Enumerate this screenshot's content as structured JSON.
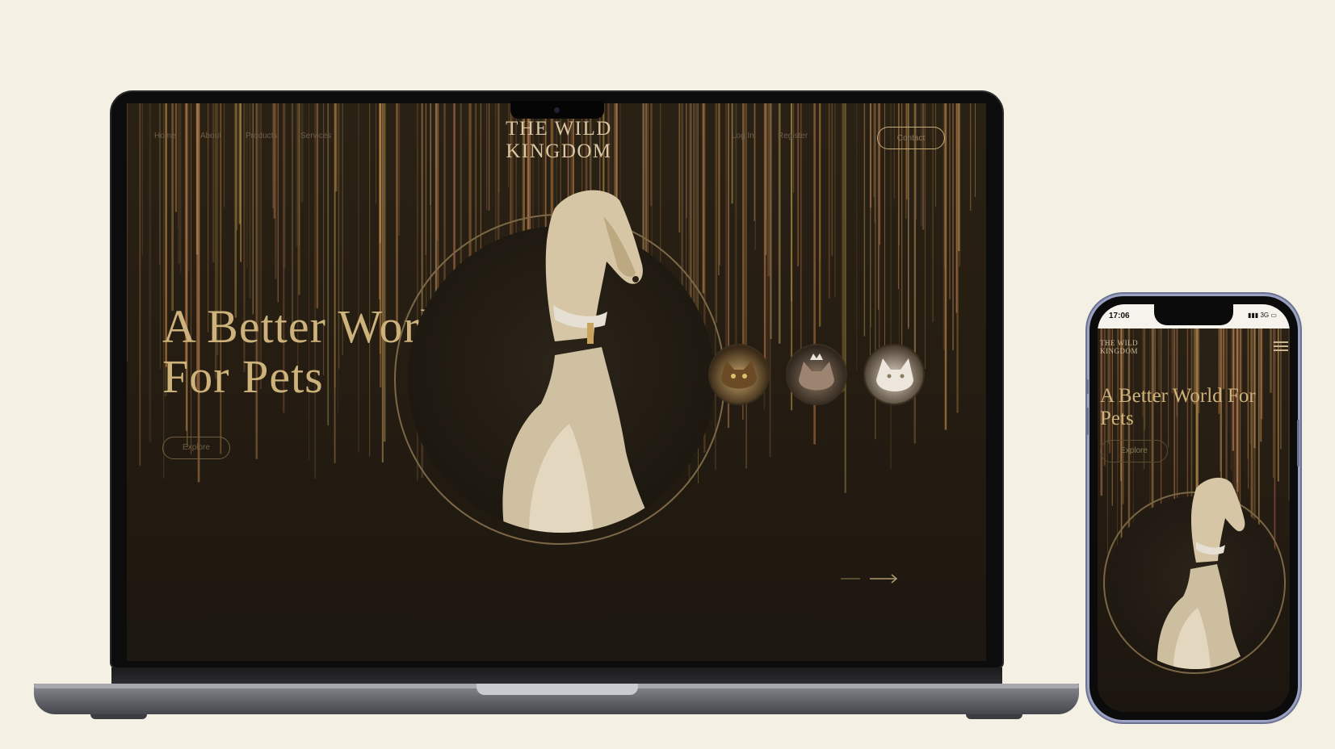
{
  "desktop": {
    "nav": {
      "left": [
        "Home",
        "About",
        "Products",
        "Services"
      ],
      "right": [
        "Log In",
        "Register"
      ],
      "contact_label": "Contact"
    },
    "logo": {
      "line1": "THE WILD",
      "line2": "KINGDOM"
    },
    "hero": {
      "title_line1": "A Better World",
      "title_line2": "For Pets",
      "button_label": "Explore"
    },
    "featured_pet": "dog-portrait-icon",
    "thumbnails": [
      "cat-portrait-icon",
      "cat-portrait-icon",
      "cat-portrait-icon"
    ]
  },
  "mobile": {
    "status": {
      "time": "17:06",
      "signal": "3G"
    },
    "logo": {
      "line1": "THE WILD",
      "line2": "KINGDOM"
    },
    "hero": {
      "title_line1": "A Better World For",
      "title_line2": "Pets",
      "button_label": "Explore"
    }
  },
  "colors": {
    "page_bg": "#f4f0e4",
    "site_bg": "#251c12",
    "gold": "#cdb27b",
    "laptop_base": "#6e7076"
  }
}
